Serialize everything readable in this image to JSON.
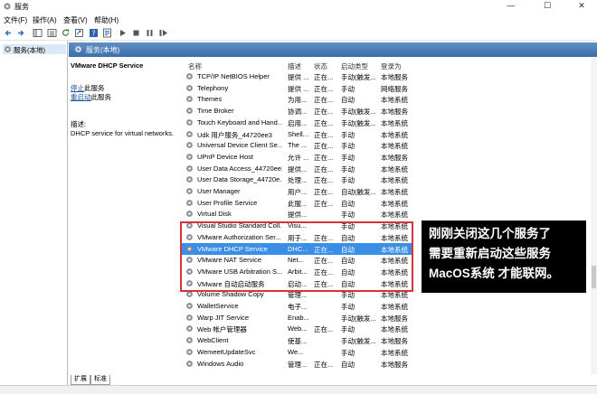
{
  "window": {
    "title": "服务",
    "minimize": "—",
    "maximize": "☐",
    "close": "✕"
  },
  "menu": [
    "文件(F)",
    "操作(A)",
    "查看(V)",
    "帮助(H)"
  ],
  "toolbar_icons": [
    "back-arrow-icon",
    "forward-arrow-icon",
    "console-tree-icon",
    "list-icon",
    "refresh-icon",
    "export-icon",
    "help-icon",
    "properties-icon",
    "play-icon",
    "stop-icon",
    "pause-icon",
    "restart-icon"
  ],
  "tree": {
    "item": "服务(本地)"
  },
  "header": {
    "label": "服务(本地)"
  },
  "detail": {
    "service_name": "VMware DHCP Service",
    "stop_link": "停止",
    "stop_suffix": "此服务",
    "restart_link": "重启动",
    "restart_suffix": "此服务",
    "desc_heading": "描述:",
    "description": "DHCP service for virtual networks."
  },
  "columns": {
    "name": "名称",
    "desc": "描述",
    "status": "状态",
    "startup": "启动类型",
    "logon": "登录为"
  },
  "services": [
    {
      "name": "TCP/IP NetBIOS Helper",
      "desc": "提供 ...",
      "status": "正在...",
      "startup": "手动(触发...",
      "logon": "本地服务"
    },
    {
      "name": "Telephony",
      "desc": "提供 ...",
      "status": "正在...",
      "startup": "手动",
      "logon": "网络服务"
    },
    {
      "name": "Themes",
      "desc": "为用...",
      "status": "正在...",
      "startup": "自动",
      "logon": "本地系统"
    },
    {
      "name": "Time Broker",
      "desc": "协调...",
      "status": "正在...",
      "startup": "手动(触发...",
      "logon": "本地服务"
    },
    {
      "name": "Touch Keyboard and Hand...",
      "desc": "启用...",
      "status": "正在...",
      "startup": "手动(触发...",
      "logon": "本地系统"
    },
    {
      "name": "Udk 用户服务_44720ee3",
      "desc": "Shell...",
      "status": "正在...",
      "startup": "手动",
      "logon": "本地系统"
    },
    {
      "name": "Universal Device Client Se...",
      "desc": "The ...",
      "status": "正在...",
      "startup": "手动",
      "logon": "本地系统"
    },
    {
      "name": "UPnP Device Host",
      "desc": "允许 ...",
      "status": "正在...",
      "startup": "手动",
      "logon": "本地服务"
    },
    {
      "name": "User Data Access_44720ee3",
      "desc": "提供...",
      "status": "正在...",
      "startup": "手动",
      "logon": "本地系统"
    },
    {
      "name": "User Data Storage_44720e...",
      "desc": "处理...",
      "status": "正在...",
      "startup": "手动",
      "logon": "本地系统"
    },
    {
      "name": "User Manager",
      "desc": "用户...",
      "status": "正在...",
      "startup": "自动(触发...",
      "logon": "本地系统"
    },
    {
      "name": "User Profile Service",
      "desc": "此服...",
      "status": "正在...",
      "startup": "自动",
      "logon": "本地系统"
    },
    {
      "name": "Virtual Disk",
      "desc": "提供...",
      "status": "",
      "startup": "手动",
      "logon": "本地系统"
    },
    {
      "name": "Visual Studio Standard Coll...",
      "desc": "Visu...",
      "status": "",
      "startup": "手动",
      "logon": "本地系统"
    },
    {
      "name": "VMware Authorization Ser...",
      "desc": "用于...",
      "status": "正在...",
      "startup": "自动",
      "logon": "本地系统"
    },
    {
      "name": "VMware DHCP Service",
      "desc": "DHC...",
      "status": "正在...",
      "startup": "自动",
      "logon": "本地系统"
    },
    {
      "name": "VMware NAT Service",
      "desc": "Net...",
      "status": "正在...",
      "startup": "自动",
      "logon": "本地系统"
    },
    {
      "name": "VMware USB Arbitration S...",
      "desc": "Arbit...",
      "status": "正在...",
      "startup": "自动",
      "logon": "本地系统"
    },
    {
      "name": "VMware 自动启动服务",
      "desc": "启动...",
      "status": "正在...",
      "startup": "自动",
      "logon": "本地系统"
    },
    {
      "name": "Volume Shadow Copy",
      "desc": "管理...",
      "status": "",
      "startup": "手动",
      "logon": "本地系统"
    },
    {
      "name": "WalletService",
      "desc": "电子...",
      "status": "",
      "startup": "手动",
      "logon": "本地系统"
    },
    {
      "name": "Warp JIT Service",
      "desc": "Enab...",
      "status": "",
      "startup": "手动(触发...",
      "logon": "本地服务"
    },
    {
      "name": "Web 帐户管理器",
      "desc": "Web...",
      "status": "正在...",
      "startup": "手动",
      "logon": "本地系统"
    },
    {
      "name": "WebClient",
      "desc": "使基...",
      "status": "",
      "startup": "手动(触发...",
      "logon": "本地服务"
    },
    {
      "name": "WemeetUpdateSvc",
      "desc": "We...",
      "status": "",
      "startup": "手动",
      "logon": "本地系统"
    },
    {
      "name": "Windows Audio",
      "desc": "管理...",
      "status": "正在...",
      "startup": "自动",
      "logon": "本地服务"
    }
  ],
  "selected_index": 15,
  "bottom_tabs": [
    "扩展",
    "标准"
  ],
  "annotation": {
    "line1": "刚刚关闭这几个服务了",
    "line2": "需要重新启动这些服务",
    "line3": "MacOS系统 才能联网。"
  },
  "colors": {
    "selection": "#3b8ee5",
    "highlight_box": "#d9323a",
    "header_bg": "#4a7cb7"
  }
}
